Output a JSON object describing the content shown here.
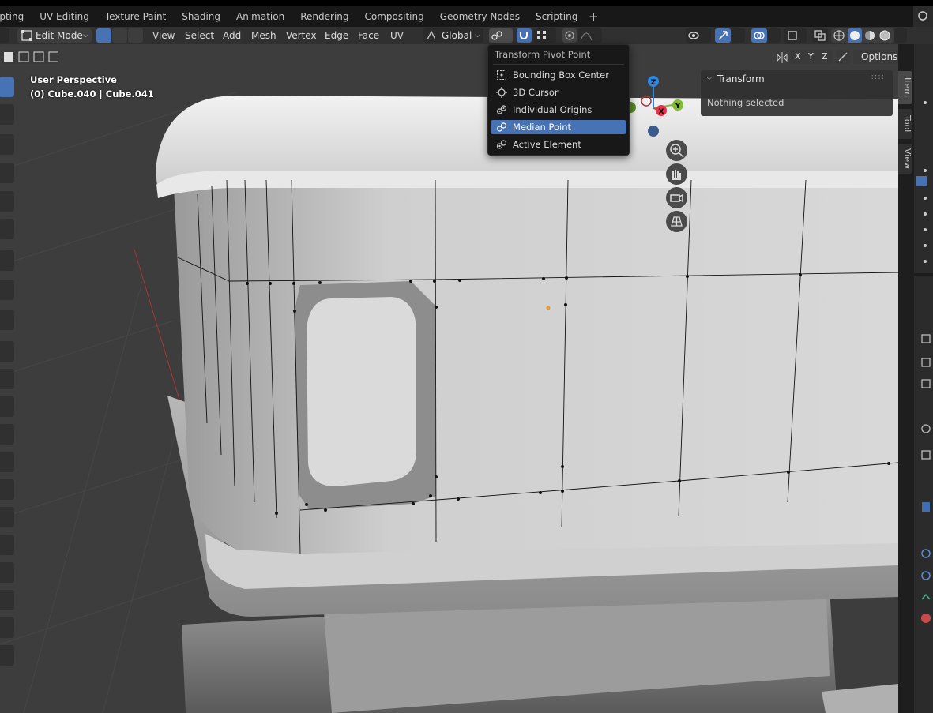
{
  "workspaces": {
    "tabs": [
      "opting",
      "UV Editing",
      "Texture Paint",
      "Shading",
      "Animation",
      "Rendering",
      "Compositing",
      "Geometry Nodes",
      "Scripting"
    ],
    "add_label": "+"
  },
  "header": {
    "mode": "Edit Mode",
    "menus": [
      "View",
      "Select",
      "Add",
      "Mesh",
      "Vertex",
      "Edge",
      "Face",
      "UV"
    ],
    "orientation": "Global",
    "options": "Options",
    "axes": [
      "X",
      "Y",
      "Z"
    ]
  },
  "viewport": {
    "perspective": "User Perspective",
    "object_info": "(0) Cube.040 | Cube.041"
  },
  "pivot_menu": {
    "title": "Transform Pivot Point",
    "items": [
      {
        "label": "Bounding Box Center",
        "icon": "bounding-box-icon",
        "selected": false
      },
      {
        "label": "3D Cursor",
        "icon": "cursor-icon",
        "selected": false
      },
      {
        "label": "Individual Origins",
        "icon": "individual-origins-icon",
        "selected": false
      },
      {
        "label": "Median Point",
        "icon": "median-point-icon",
        "selected": true
      },
      {
        "label": "Active Element",
        "icon": "active-element-icon",
        "selected": false
      }
    ]
  },
  "n_panel": {
    "section": "Transform",
    "message": "Nothing selected",
    "tabs": [
      "Item",
      "Tool",
      "View"
    ]
  },
  "gizmo": {
    "x": "X",
    "y": "Y",
    "z": "Z",
    "x_color": "#e5334d",
    "y_color": "#82bd31",
    "z_color": "#2d86e0"
  },
  "colors": {
    "accent": "#4772b3",
    "viewport_bg": "#3d3d3d",
    "menu_bg": "#181818"
  }
}
